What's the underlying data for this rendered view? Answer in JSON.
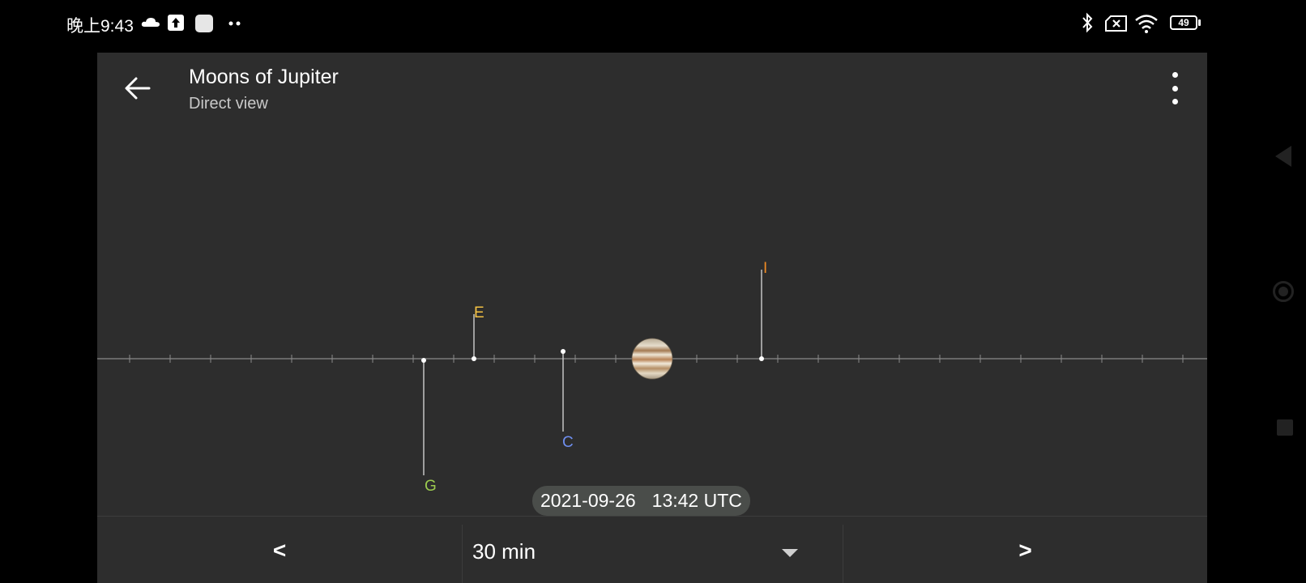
{
  "status_bar": {
    "time": "晚上9:43",
    "battery": "49",
    "icons": [
      "cloud-icon",
      "upload-icon",
      "app-icon",
      "more-dots-icon",
      "bluetooth-icon",
      "no-sim-icon",
      "wifi-icon",
      "battery-icon"
    ]
  },
  "toolbar": {
    "title": "Moons of Jupiter",
    "subtitle": "Direct view",
    "back_icon": "arrow-left-icon",
    "menu_icon": "more-vert-icon"
  },
  "moons": [
    {
      "label": "I",
      "color": "#f08a24"
    },
    {
      "label": "E",
      "color": "#f5c244"
    },
    {
      "label": "C",
      "color": "#6f8ff0"
    },
    {
      "label": "G",
      "color": "#9ccb4f"
    }
  ],
  "timestamp": {
    "date": "2021-09-26",
    "time": "13:42 UTC"
  },
  "controls": {
    "prev_label": "<",
    "step_value": "30 min",
    "next_label": ">"
  }
}
